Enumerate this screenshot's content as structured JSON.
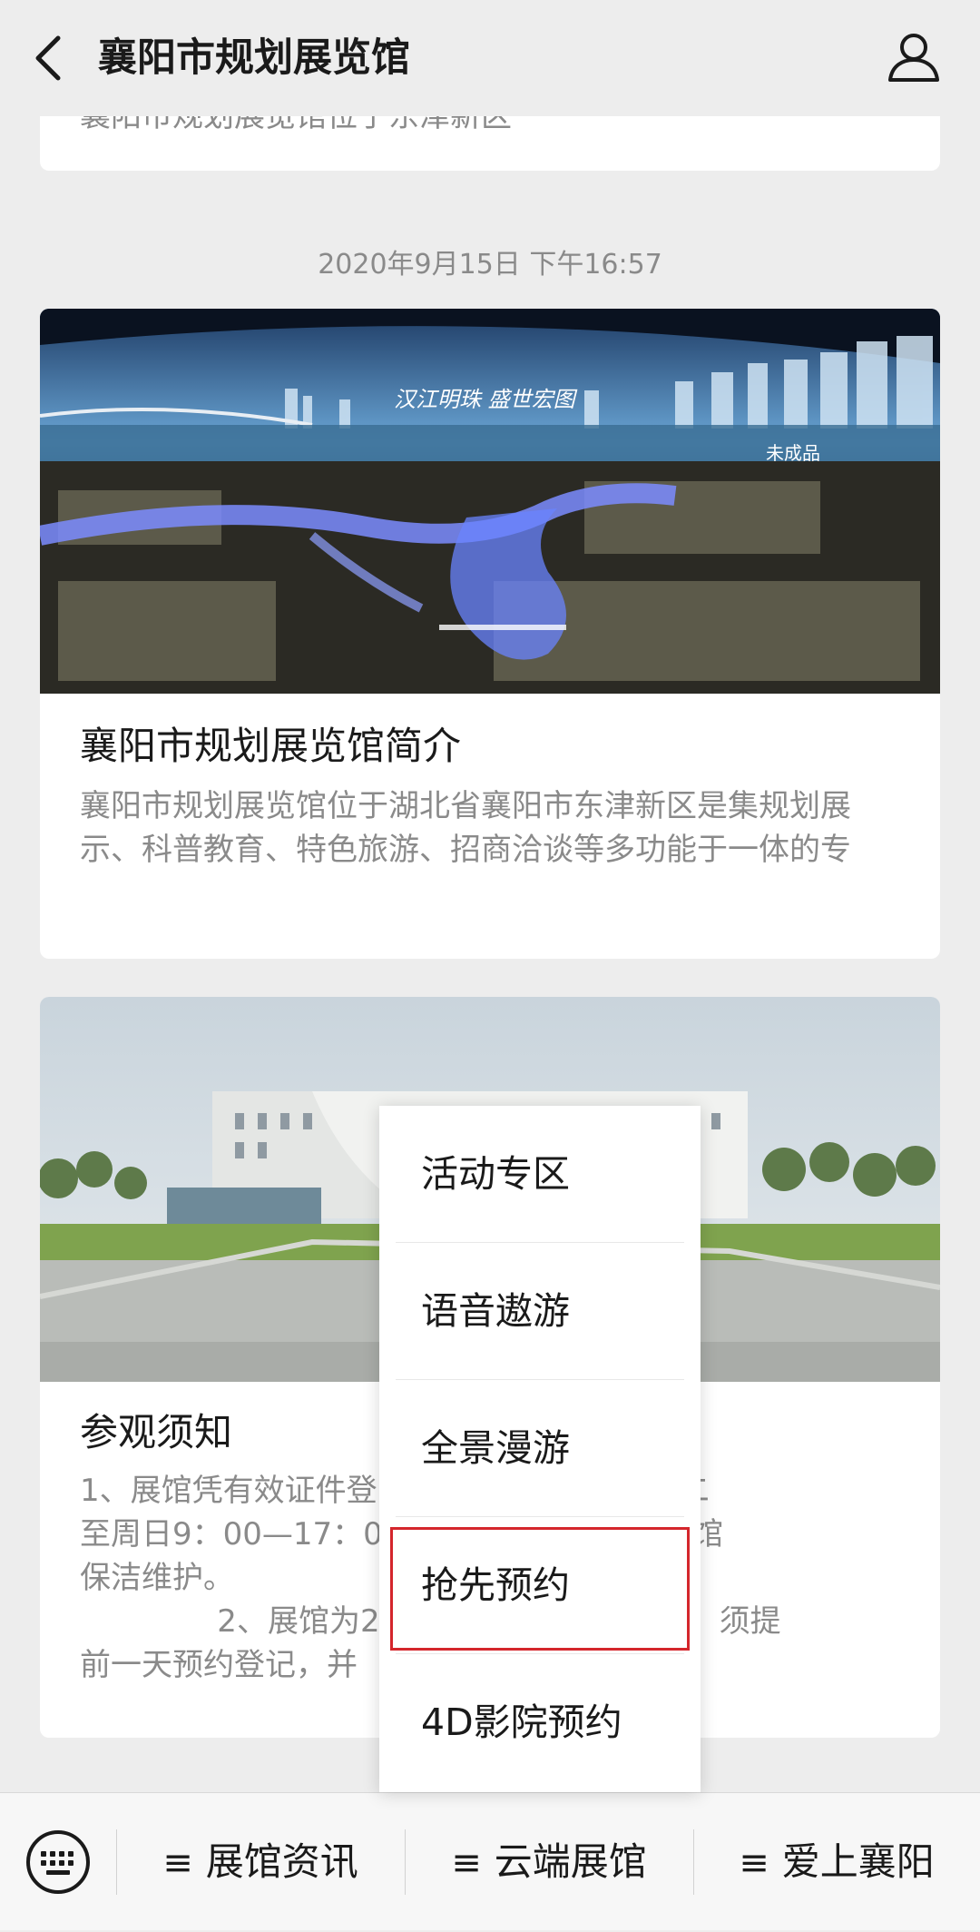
{
  "header": {
    "title": "襄阳市规划展览馆"
  },
  "previous_card": {
    "clipped_text": "襄阳市规划展览馆位于东津新区"
  },
  "timestamp": "2020年9月15日 下午16:57",
  "articles": [
    {
      "title": "襄阳市规划展览馆简介",
      "description": "襄阳市规划展览馆位于湖北省襄阳市东津新区是集规划展示、科普教育、特色旅游、招商洽谈等多功能于一体的专",
      "image": {
        "overlay_text": "汉江明珠 盛世宏图",
        "watermark": "未成品"
      }
    },
    {
      "title": "参观须知",
      "description": "1、展馆凭有效证件登               时间：每周二\n至周日9：00—17：0                   ，周一闭馆\n保洁维护。\n              2、展馆为20人l                解服务，须提\n前一天预约登记，并"
    }
  ],
  "popup_menu": {
    "items": [
      "活动专区",
      "语音遨游",
      "全景漫游",
      "抢先预约",
      "4D影院预约"
    ],
    "highlighted_index": 3,
    "highlight_color": "#d4262c"
  },
  "bottom_menu": {
    "tabs": [
      "展馆资讯",
      "云端展馆",
      "爱上襄阳"
    ],
    "menu_glyph": "≡"
  },
  "icons": {
    "back": "chevron-left-icon",
    "profile": "person-icon",
    "keyboard": "keyboard-icon"
  }
}
